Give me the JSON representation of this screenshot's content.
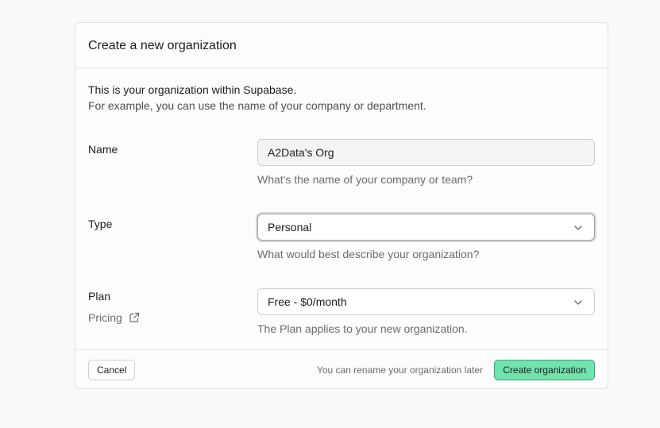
{
  "dialog": {
    "title": "Create a new organization",
    "intro_line1": "This is your organization within Supabase.",
    "intro_line2": "For example, you can use the name of your company or department."
  },
  "fields": {
    "name": {
      "label": "Name",
      "value": "A2Data's Org",
      "help": "What's the name of your company or team?"
    },
    "type": {
      "label": "Type",
      "value": "Personal",
      "help": "What would best describe your organization?"
    },
    "plan": {
      "label": "Plan",
      "value": "Free - $0/month",
      "help": "The Plan applies to your new organization.",
      "pricing_link": "Pricing"
    }
  },
  "footer": {
    "cancel_label": "Cancel",
    "note": "You can rename your organization later",
    "create_label": "Create organization"
  },
  "icons": {
    "chevron": "chevron-down-icon",
    "external": "external-link-icon"
  },
  "colors": {
    "primary_button": "#72e3ad",
    "primary_border": "#3aa776"
  }
}
